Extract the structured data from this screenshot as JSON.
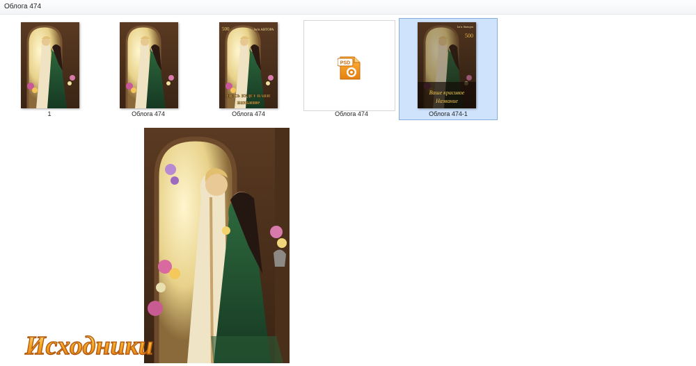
{
  "window": {
    "title": "Облога 474"
  },
  "files": [
    {
      "label": "1",
      "kind": "image",
      "variant": "plain",
      "selected": false
    },
    {
      "label": "Облога  474",
      "kind": "image",
      "variant": "plain",
      "selected": false
    },
    {
      "label": "Облога 474",
      "kind": "image",
      "variant": "text",
      "selected": false
    },
    {
      "label": "Облога 474",
      "kind": "psd",
      "variant": "psd",
      "selected": false
    },
    {
      "label": "Облога 474-1",
      "kind": "image",
      "variant": "dark-text",
      "selected": true
    }
  ],
  "cover_texts": {
    "number": "500",
    "author": "Ім'я АВТОРА",
    "title_line1": "ЗДЕСЬ БУДЕТ ВАШЕ",
    "title_line2": "название",
    "dark_number": "500",
    "dark_author": "Ім'я Автора",
    "dark_title_line1": "Ваше красивое",
    "dark_title_line2": "Название"
  },
  "psd_icon": {
    "badge": "PSD"
  },
  "watermark": {
    "text": "Исходники"
  },
  "colors": {
    "selection_bg": "#cfe3fc",
    "selection_border": "#84acdd",
    "dress_green": "#1f4a2c",
    "gold": "#d9a93a",
    "psd_orange": "#f29a1d"
  }
}
